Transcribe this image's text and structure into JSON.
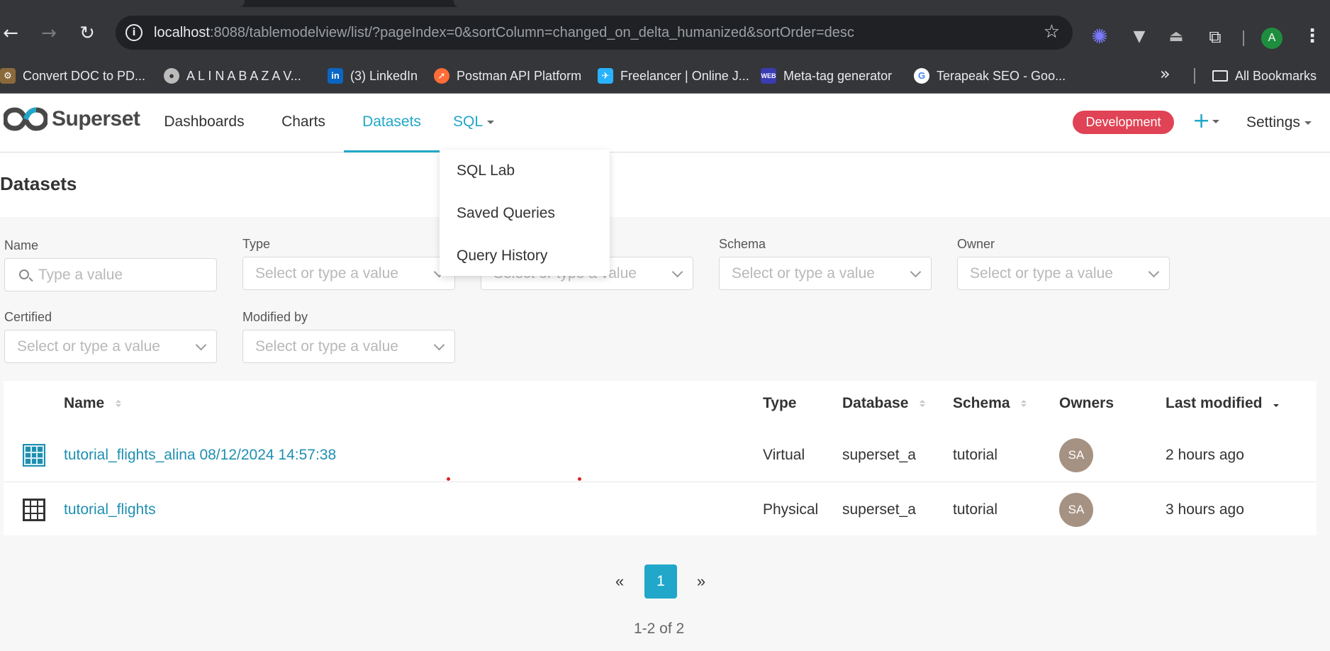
{
  "browser": {
    "url_host": "localhost",
    "url_rest": ":8088/tablemodelview/list/?pageIndex=0&sortColumn=changed_on_delta_humanized&sortOrder=desc",
    "profile_initial": "A",
    "bookmarks": [
      {
        "label": "Convert DOC to PD...",
        "icon": "pdf-converter-icon"
      },
      {
        "label": "A L I N A   B A Z A V...",
        "icon": "globe-icon"
      },
      {
        "label": "(3) LinkedIn",
        "icon": "linkedin-icon"
      },
      {
        "label": "Postman API Platform",
        "icon": "postman-icon"
      },
      {
        "label": "Freelancer | Online J...",
        "icon": "freelancer-icon"
      },
      {
        "label": "Meta-tag generator",
        "icon": "web-icon"
      },
      {
        "label": "Terapeak SEO - Goo...",
        "icon": "google-icon"
      }
    ],
    "bookmarks_more": "»",
    "all_bookmarks": "All Bookmarks"
  },
  "header": {
    "brand": "Superset",
    "nav": [
      "Dashboards",
      "Charts",
      "Datasets",
      "SQL"
    ],
    "active_nav": "Datasets",
    "env_badge": "Development",
    "plus": "+",
    "settings": "Settings"
  },
  "sql_menu": [
    "SQL Lab",
    "Saved Queries",
    "Query History"
  ],
  "page": {
    "title": "Datasets"
  },
  "filters": {
    "name_label": "Name",
    "name_placeholder": "Type a value",
    "type_label": "Type",
    "database_placeholder": "Select or type a value",
    "schema_label": "Schema",
    "owner_label": "Owner",
    "certified_label": "Certified",
    "modified_by_label": "Modified by",
    "select_placeholder": "Select or type a value"
  },
  "table": {
    "columns": [
      "Name",
      "Type",
      "Database",
      "Schema",
      "Owners",
      "Last modified"
    ],
    "sorted_column": "Last modified",
    "sort_order": "desc",
    "rows": [
      {
        "name": "tutorial_flights_alina 08/12/2024 14:57:38",
        "type": "Virtual",
        "database": "superset_a",
        "schema": "tutorial",
        "owner": "SA",
        "modified": "2 hours ago"
      },
      {
        "name": "tutorial_flights",
        "type": "Physical",
        "database": "superset_a",
        "schema": "tutorial",
        "owner": "SA",
        "modified": "3 hours ago"
      }
    ]
  },
  "pagination": {
    "prev": "«",
    "current": "1",
    "next": "»",
    "range": "1-2 of 2"
  },
  "colors": {
    "accent": "#20a7c9",
    "env_badge": "#e04355",
    "avatar": "#a69282"
  }
}
